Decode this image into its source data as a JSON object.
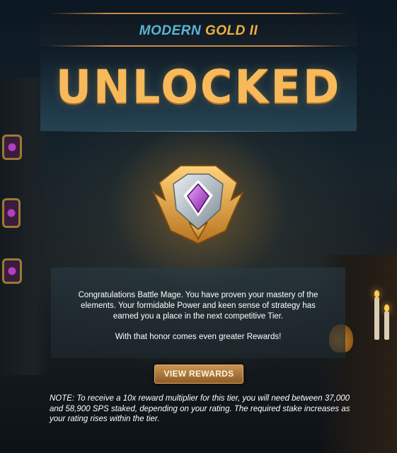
{
  "header": {
    "tier_prefix": "MODERN",
    "tier_name": "GOLD II"
  },
  "hero": {
    "title": "UNLOCKED"
  },
  "message": {
    "line1": "Congratulations Battle Mage. You have proven your mastery of the elements. Your formidable Power and keen sense of strategy has earned you a place in the next competitive Tier.",
    "line2": "With that honor comes even greater Rewards!"
  },
  "actions": {
    "view_rewards_label": "VIEW REWARDS"
  },
  "note": {
    "text": "NOTE: To receive a 10x reward multiplier for this tier, you will need between 37,000 and 58,900 SPS staked, depending on your rating. The required stake increases as your rating rises within the tier."
  },
  "icons": {
    "emblem": "gold-ii-league-emblem-icon"
  },
  "colors": {
    "tier_prefix": "#5ab4d6",
    "tier_name": "#f0b040",
    "title": "#f7b95a",
    "button": "#b07a3e"
  }
}
